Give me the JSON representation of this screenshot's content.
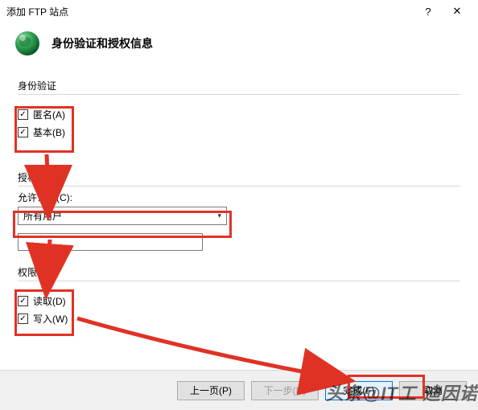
{
  "window": {
    "title": "添加 FTP 站点",
    "help": "?",
    "close": "✕"
  },
  "header": {
    "title": "身份验证和授权信息"
  },
  "auth": {
    "section": "身份验证",
    "anonymous": "匿名(A)",
    "basic": "基本(B)",
    "check": "✓"
  },
  "authorization": {
    "section": "授权",
    "allow_access_label": "允许访问(C):",
    "selected": "所有用户"
  },
  "permissions": {
    "section": "权限",
    "read": "读取(D)",
    "write": "写入(W)",
    "check": "✓"
  },
  "footer": {
    "prev": "上一页(P)",
    "next": "下一步(N)",
    "finish": "完成(F)",
    "cancel": "取消"
  },
  "watermark": "头条@IT工 迪因诺"
}
